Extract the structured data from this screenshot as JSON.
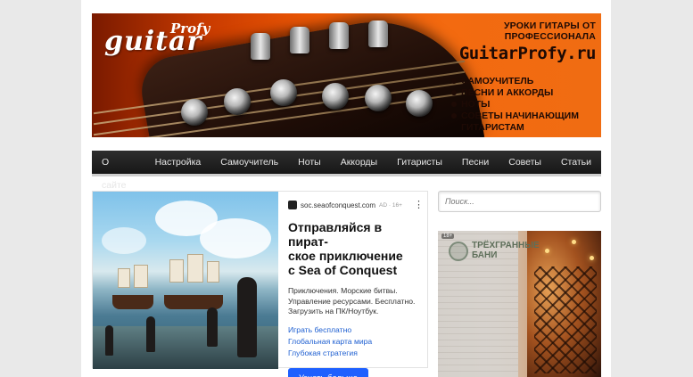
{
  "banner": {
    "logo_main": "guitar",
    "logo_sup": "Profy",
    "tagline": "УРОКИ ГИТАРЫ ОТ ПРОФЕССИОНАЛА",
    "site_name": "GuitarProfy.ru",
    "features": [
      "САМОУЧИТЕЛЬ",
      "ПЕСНИ И АККОРДЫ",
      "НОТЫ",
      "СОВЕТЫ НАЧИНАЮЩИМ ГИТАРИСТАМ"
    ]
  },
  "nav": {
    "items": [
      "О сайте",
      "Настройка",
      "Самоучитель",
      "Ноты",
      "Аккорды",
      "Гитаристы",
      "Песни",
      "Советы",
      "Статьи"
    ]
  },
  "ad": {
    "domain": "soc.seaofconquest.com",
    "marker": "AD · 16+",
    "menu": "⋮",
    "title": "Отправляйся в пират-\nское приключение\nс Sea of Conquest",
    "description": "Приключения. Морские битвы.\nУправление ресурсами. Бесплатно.\nЗагрузить на ПК/Ноутбук.",
    "links": [
      "Играть бесплатно",
      "Глобальная карта мира",
      "Глубокая стратегия"
    ],
    "button": "Узнать больше"
  },
  "search": {
    "placeholder": "Поиск..."
  },
  "side_ad": {
    "badge": "18+",
    "logo_text": "ТРЁХГРАННЫЕ\nБАНИ"
  }
}
